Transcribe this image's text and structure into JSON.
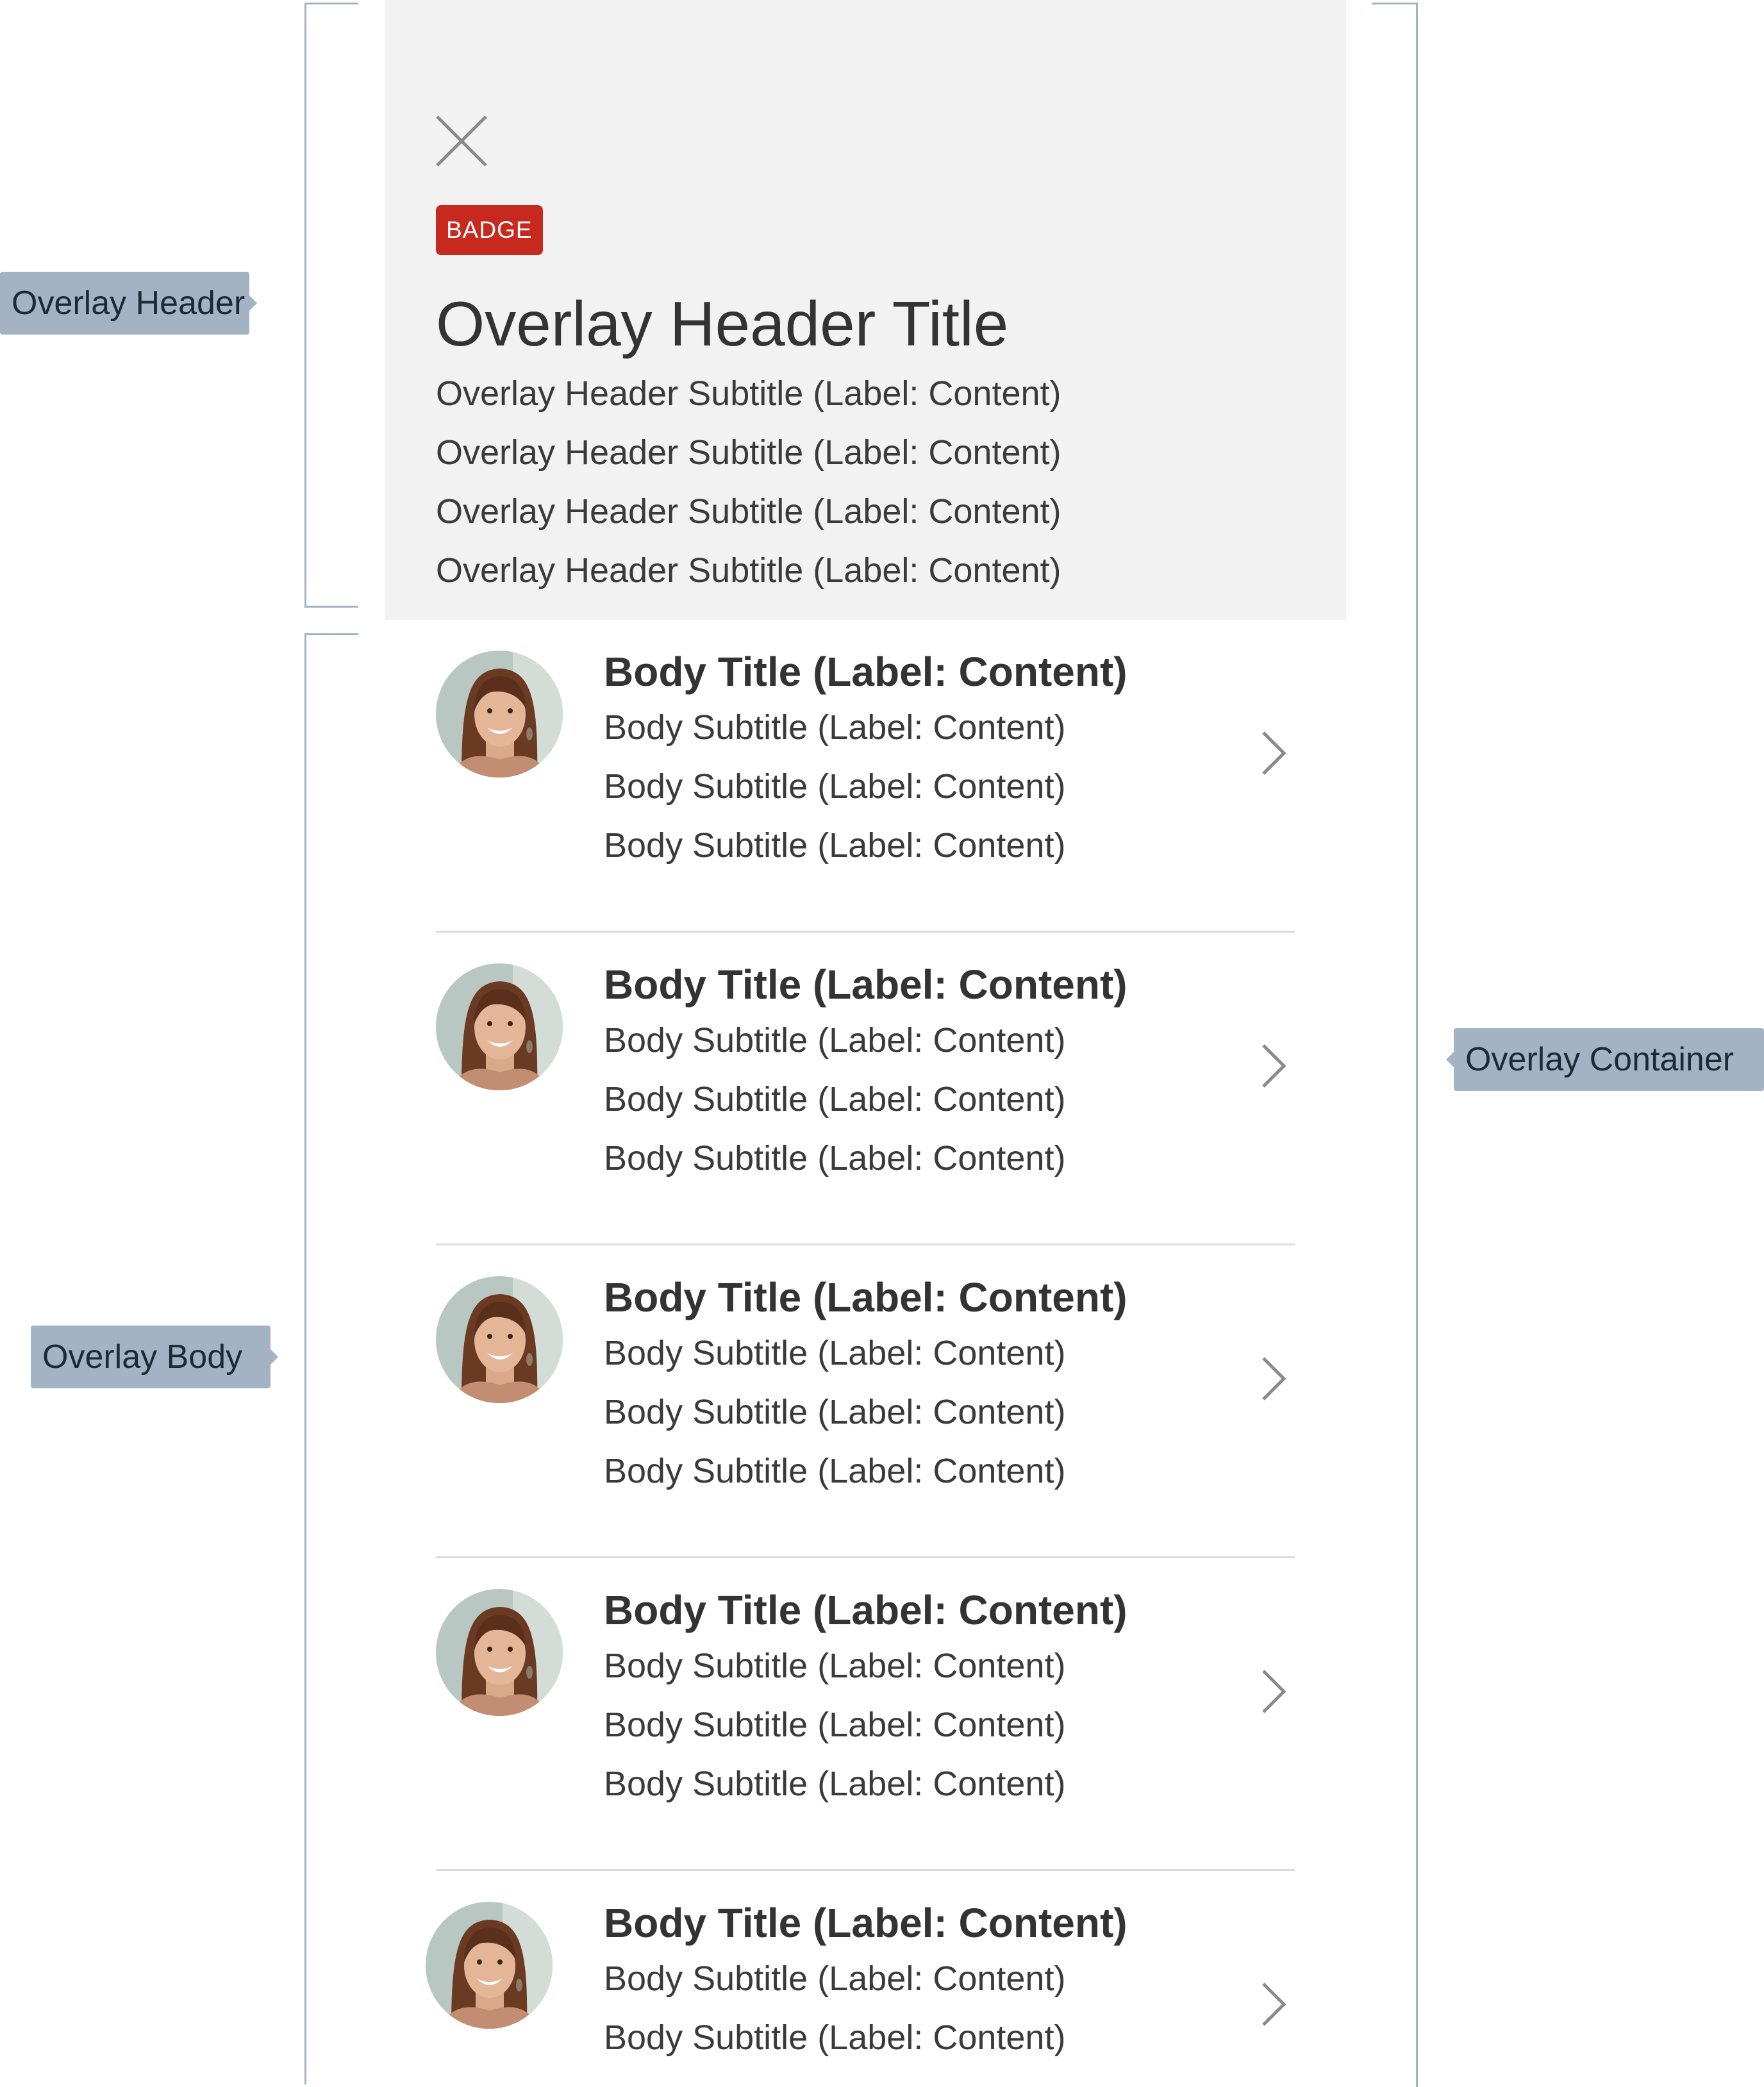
{
  "annotations": {
    "overlay_header": "Overlay Header",
    "overlay_body": "Overlay Body",
    "overlay_container": "Overlay Container"
  },
  "header": {
    "close_icon": "close-icon",
    "badge": "BADGE",
    "title": "Overlay Header Title",
    "subtitles": [
      "Overlay Header Subtitle (Label: Content)",
      "Overlay Header Subtitle (Label: Content)",
      "Overlay Header Subtitle (Label: Content)",
      "Overlay Header Subtitle (Label: Content)"
    ]
  },
  "body": {
    "items": [
      {
        "title": "Body Title (Label: Content)",
        "subtitles": [
          "Body Subtitle (Label: Content)",
          "Body Subtitle (Label: Content)",
          "Body Subtitle (Label: Content)"
        ],
        "avatar": "avatar-photo",
        "chevron": "chevron-right-icon"
      },
      {
        "title": "Body Title (Label: Content)",
        "subtitles": [
          "Body Subtitle (Label: Content)",
          "Body Subtitle (Label: Content)",
          "Body Subtitle (Label: Content)"
        ],
        "avatar": "avatar-photo",
        "chevron": "chevron-right-icon"
      },
      {
        "title": "Body Title (Label: Content)",
        "subtitles": [
          "Body Subtitle (Label: Content)",
          "Body Subtitle (Label: Content)",
          "Body Subtitle (Label: Content)"
        ],
        "avatar": "avatar-photo",
        "chevron": "chevron-right-icon"
      },
      {
        "title": "Body Title (Label: Content)",
        "subtitles": [
          "Body Subtitle (Label: Content)",
          "Body Subtitle (Label: Content)",
          "Body Subtitle (Label: Content)"
        ],
        "avatar": "avatar-photo",
        "chevron": "chevron-right-icon"
      },
      {
        "title": "Body Title (Label: Content)",
        "subtitles": [
          "Body Subtitle (Label: Content)",
          "Body Subtitle (Label: Content)"
        ],
        "avatar": "avatar-photo",
        "chevron": "chevron-right-icon"
      }
    ]
  },
  "colors": {
    "header_background": "#f2f2f2",
    "badge_background": "#c8291f",
    "annotation": "#a3b3c3",
    "text": "#333333",
    "divider": "#dcdcdc"
  }
}
